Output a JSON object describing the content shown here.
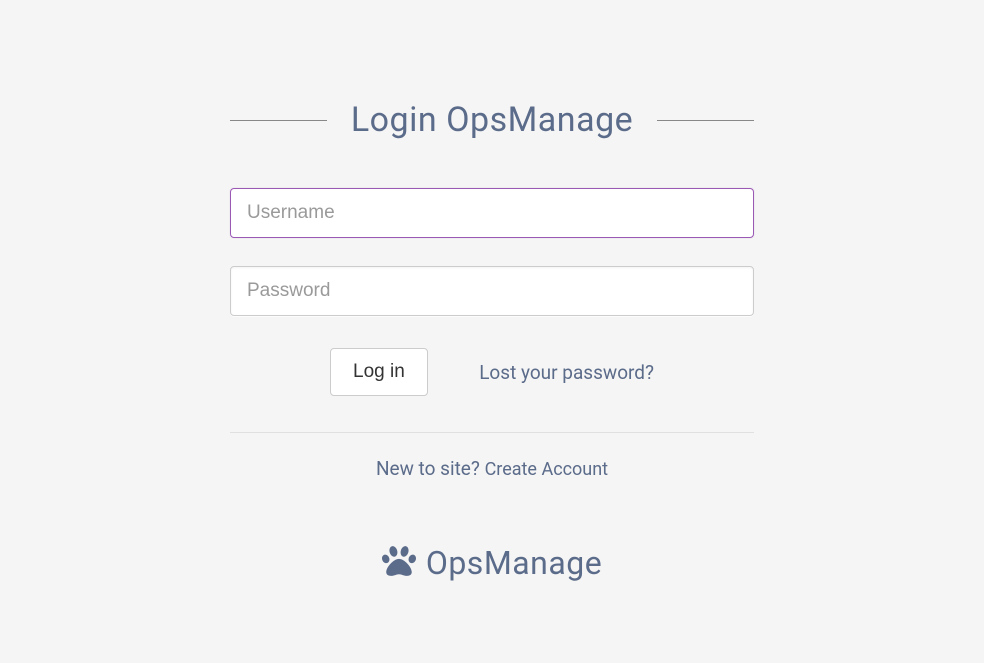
{
  "title": "Login OpsManage",
  "form": {
    "username_placeholder": "Username",
    "username_value": "",
    "password_placeholder": "Password",
    "password_value": "",
    "login_button": "Log in",
    "lost_password": "Lost your password?"
  },
  "signup": {
    "prompt": "New to site? ",
    "link": "Create Account"
  },
  "brand": {
    "name": "OpsManage"
  }
}
